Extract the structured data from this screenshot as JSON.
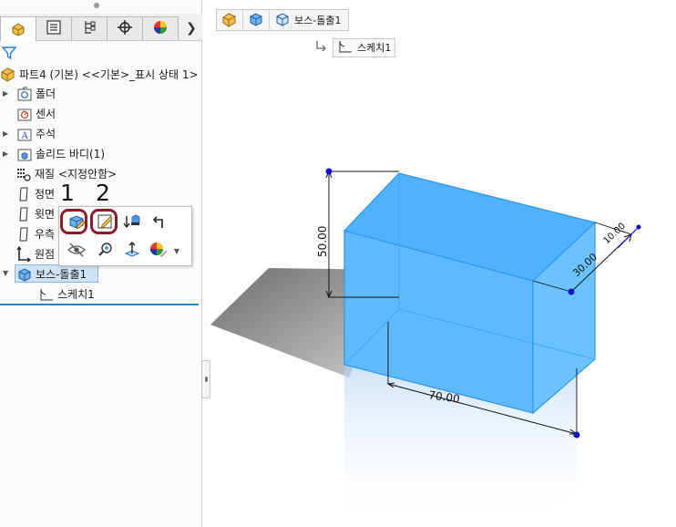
{
  "feature_tree": {
    "root_label": "파트4 (기본) <<기본>_표시 상태 1>",
    "items": [
      {
        "label": "폴더",
        "icon": "history-folder-icon",
        "expandable": true
      },
      {
        "label": "센서",
        "icon": "sensor-folder-icon",
        "expandable": false
      },
      {
        "label": "주석",
        "icon": "annotation-folder-icon",
        "expandable": true
      },
      {
        "label": "솔리드 바디(1)",
        "icon": "solid-body-folder-icon",
        "expandable": true
      },
      {
        "label": "재질 <지정안함>",
        "icon": "material-icon",
        "expandable": false
      },
      {
        "label": "정면",
        "icon": "plane-icon",
        "expandable": false
      },
      {
        "label": "윗면",
        "icon": "plane-icon",
        "expandable": false
      },
      {
        "label": "우측",
        "icon": "plane-icon",
        "expandable": false
      },
      {
        "label": "원점",
        "icon": "origin-icon",
        "expandable": false
      },
      {
        "label": "보스-돌출1",
        "icon": "boss-extrude-icon",
        "expandable": true,
        "selected": true
      },
      {
        "label": "스케치1",
        "icon": "sketch-icon",
        "expandable": false
      }
    ]
  },
  "tabs": [
    {
      "name": "feature-manager-tab",
      "icon": "feature-manager-icon"
    },
    {
      "name": "property-manager-tab",
      "icon": "property-manager-icon"
    },
    {
      "name": "configuration-manager-tab",
      "icon": "configuration-manager-icon"
    },
    {
      "name": "dimxpert-manager-tab",
      "icon": "dimxpert-icon"
    },
    {
      "name": "display-manager-tab",
      "icon": "display-manager-icon"
    }
  ],
  "context_toolbar": {
    "callouts": [
      "1",
      "2"
    ],
    "buttons": [
      "edit-feature-icon",
      "edit-sketch-icon",
      "rollback-icon",
      "parent-child-icon",
      "hide-icon",
      "zoom-to-selection-icon",
      "normal-to-icon",
      "appearance-icon",
      "dropdown-arrow-icon"
    ]
  },
  "breadcrumb": {
    "feature_label": "보스-돌출1",
    "sketch_label": "스케치1"
  },
  "dimensions": {
    "height": "50.00",
    "width": "70.00",
    "depth": "30.00",
    "extra": "10.00"
  },
  "colors": {
    "body_blue": "#58b7ff",
    "edge_blue": "#2f95ef",
    "highlight_red": "#8b1c2c",
    "shadow_gray": "#8c8c8c",
    "dim_point": "#1212c8"
  }
}
